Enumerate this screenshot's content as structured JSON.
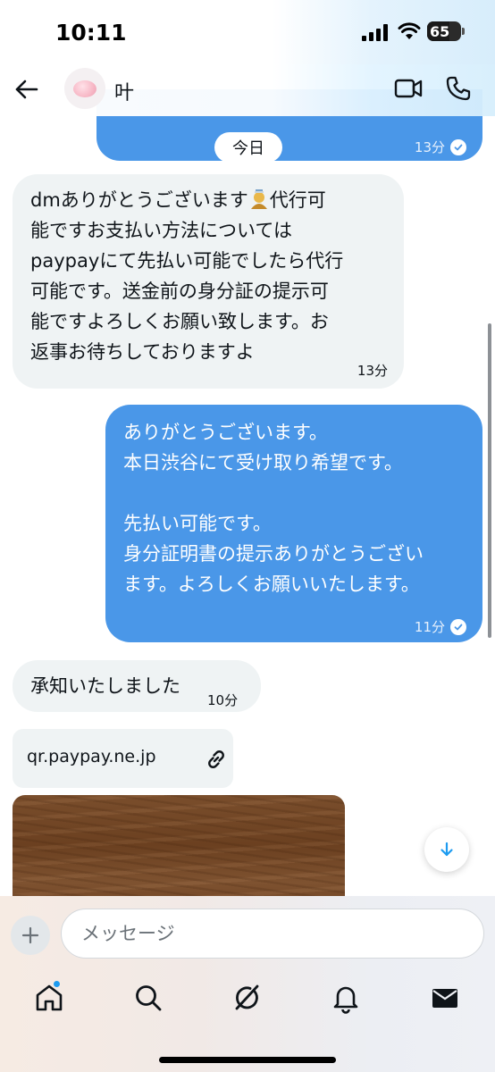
{
  "status_bar": {
    "time": "10:11",
    "battery": "65",
    "battery_level": 0.65
  },
  "header": {
    "contact_name": "叶"
  },
  "messages": [
    {
      "direction": "out",
      "time": "13分",
      "partial": true
    },
    {
      "direction": "in",
      "time": "13分",
      "lines": [
        "dmありがとうございます",
        "代行可",
        "能ですお支払い方法については",
        "paypayにて先払い可能でしたら代行",
        "可能です。送金前の身分証の提示可",
        "能ですよろしくお願い致します。お",
        "返事お待ちしておりますよ"
      ]
    },
    {
      "direction": "out",
      "time": "11分",
      "lines": [
        "ありがとうございます。",
        "本日渋谷にて受け取り希望です。",
        "",
        "先払い可能です。",
        "身分証明書の提示ありがとうござい",
        "ます。よろしくお願いいたします。"
      ]
    },
    {
      "direction": "in",
      "time": "10分",
      "text": "承知いたしました"
    }
  ],
  "date_divider": "今日",
  "link_card": {
    "text": "qr.paypay.ne.jp",
    "icon": "link-icon"
  },
  "composer": {
    "placeholder": "メッセージ",
    "value": ""
  },
  "tabs": [
    {
      "name": "home",
      "icon": "home-icon",
      "active": true,
      "has_badge": true
    },
    {
      "name": "search",
      "icon": "search-icon"
    },
    {
      "name": "grok",
      "icon": "grok-icon"
    },
    {
      "name": "notifications",
      "icon": "bell-icon"
    },
    {
      "name": "messages",
      "icon": "envelope-icon",
      "active": true
    }
  ],
  "colors": {
    "outgoing_bubble": "#4a97e8",
    "incoming_bubble": "#eff3f4",
    "accent": "#1d9bf0"
  }
}
